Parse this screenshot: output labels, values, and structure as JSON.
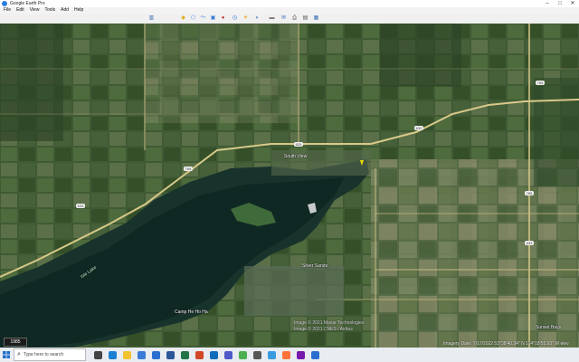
{
  "window": {
    "title": "Google Earth Pro",
    "controls": [
      "–",
      "□",
      "✕"
    ]
  },
  "menu": {
    "items": [
      "File",
      "Edit",
      "View",
      "Tools",
      "Add",
      "Help"
    ]
  },
  "toolbar": {
    "buttons": [
      {
        "icon": "sidebar-toggle-icon",
        "glyph": "▥",
        "color": "#3a6fb5"
      },
      {
        "icon": "placemark-icon",
        "glyph": "◆",
        "color": "#e0b020"
      },
      {
        "icon": "polygon-icon",
        "glyph": "⬠",
        "color": "#3a7ad8"
      },
      {
        "icon": "path-icon",
        "glyph": "〜",
        "color": "#3a7ad8"
      },
      {
        "icon": "overlay-icon",
        "glyph": "▣",
        "color": "#3a7ad8"
      },
      {
        "icon": "tour-icon",
        "glyph": "●",
        "color": "#c33"
      },
      {
        "icon": "historical-imagery-icon",
        "glyph": "◷",
        "color": "#2e6fd6"
      },
      {
        "icon": "sun-icon",
        "glyph": "☀",
        "color": "#e2a000"
      },
      {
        "icon": "planets-icon",
        "glyph": "◑",
        "color": "#3a6fb5"
      },
      {
        "icon": "ruler-icon",
        "glyph": "▬",
        "color": "#777"
      },
      {
        "icon": "email-icon",
        "glyph": "✉",
        "color": "#3a6fb5"
      },
      {
        "icon": "print-icon",
        "glyph": "⎙",
        "color": "#555"
      },
      {
        "icon": "save-image-icon",
        "glyph": "▤",
        "color": "#555"
      },
      {
        "icon": "maps-icon",
        "glyph": "▦",
        "color": "#3a6fb5"
      }
    ]
  },
  "map": {
    "labels": {
      "south_view": "South View",
      "silver_sands": "Silver Sands",
      "camp_he_ho_ha": "Camp He Ho Ha",
      "sunset_bays": "Sunset Bays",
      "lake": "Isle Lake"
    },
    "roads": {
      "shield_a": "633",
      "shield_b": "765",
      "shield_c": "633",
      "shield_d": "633",
      "shield_e": "765",
      "shield_f": "765",
      "shield_g": "633"
    }
  },
  "status": {
    "copyright1": "Image © 2021 Maxar Technologies",
    "copyright2": "Image © 2021 CNES / Airbus",
    "imagery": "Imagery Date: 7/17/2022   53°38'40.34\" N 114°18'55.93\" W  elev",
    "scale_label": "1985"
  },
  "taskbar": {
    "search_placeholder": "Type here to search",
    "apps": [
      {
        "name": "task-view",
        "color": "#444"
      },
      {
        "name": "edge",
        "color": "#1b7fd4"
      },
      {
        "name": "file-explorer",
        "color": "#f2c230"
      },
      {
        "name": "store",
        "color": "#3a7ad8"
      },
      {
        "name": "mail",
        "color": "#2a6fd0"
      },
      {
        "name": "word",
        "color": "#2b579a"
      },
      {
        "name": "excel",
        "color": "#217346"
      },
      {
        "name": "powerpoint",
        "color": "#d24726"
      },
      {
        "name": "outlook",
        "color": "#0f6cbd"
      },
      {
        "name": "teams",
        "color": "#5059c9"
      },
      {
        "name": "chrome",
        "color": "#4caf50"
      },
      {
        "name": "settings",
        "color": "#555"
      },
      {
        "name": "google-earth",
        "color": "#3a9be0"
      },
      {
        "name": "firefox",
        "color": "#ff7139"
      },
      {
        "name": "onenote",
        "color": "#7719aa"
      },
      {
        "name": "photos",
        "color": "#2a6fd0"
      }
    ]
  }
}
